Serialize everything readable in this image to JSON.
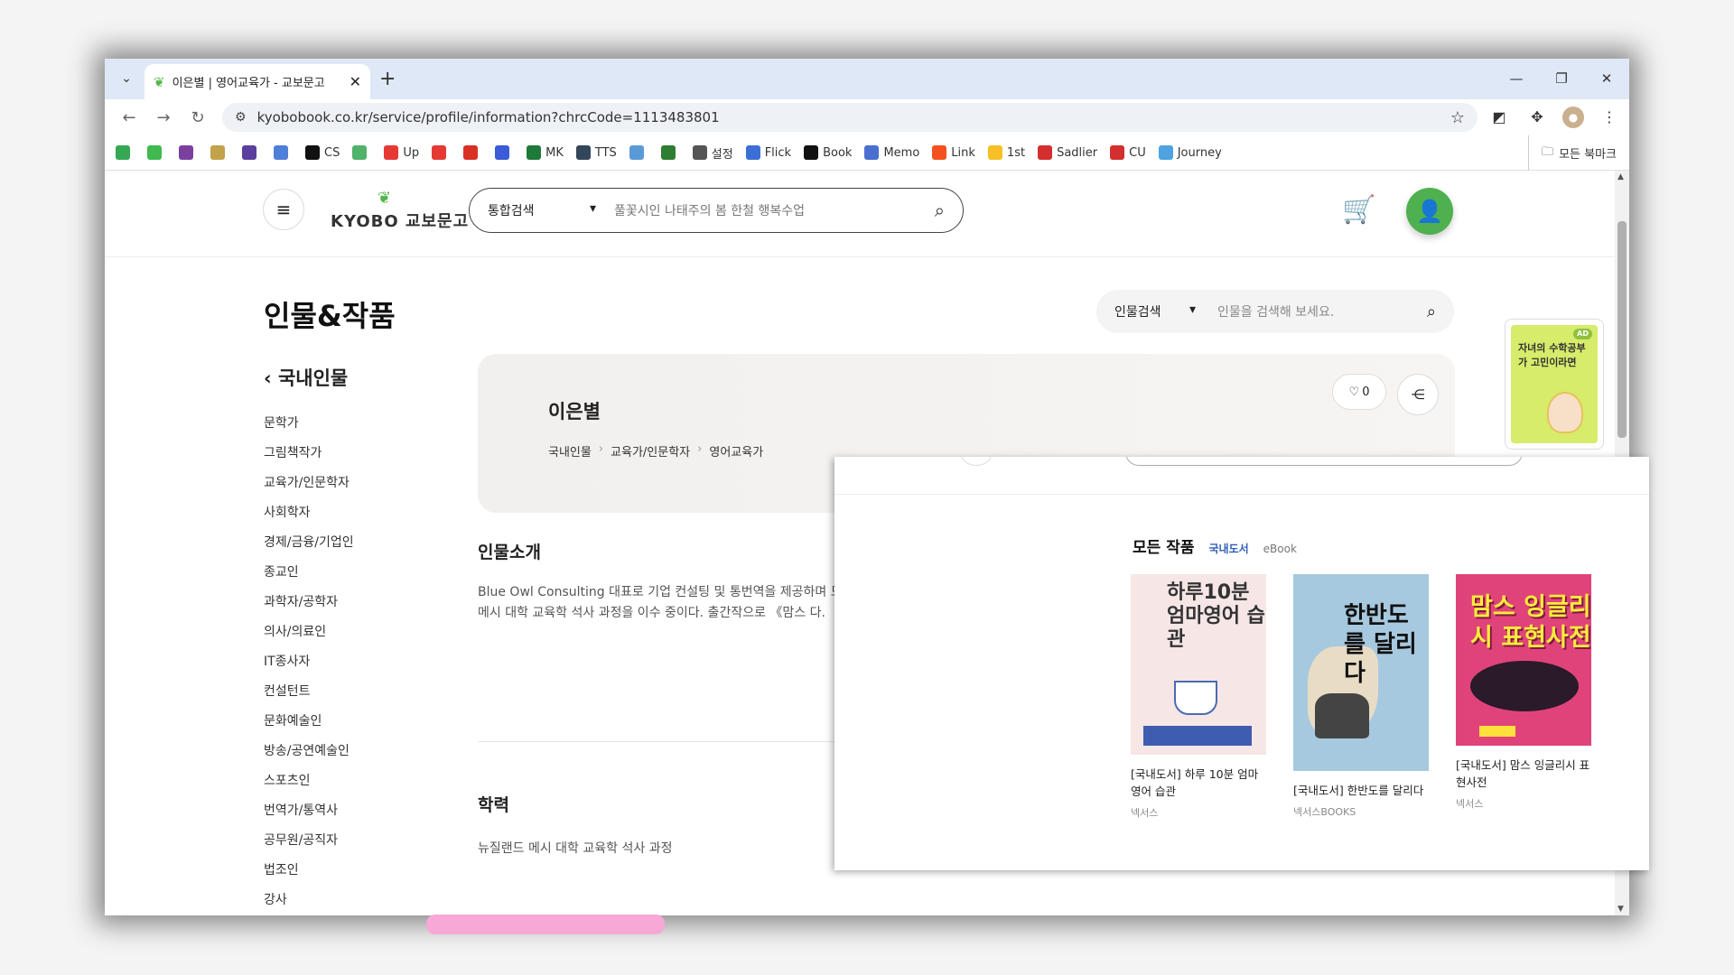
{
  "browser": {
    "tab_title": "이은별 | 영어교육가 - 교보문고",
    "url": "kyobobook.co.kr/service/profile/information?chrcCode=1113483801",
    "bookmarks": [
      {
        "label": "",
        "color": "#34a853"
      },
      {
        "label": "",
        "color": "#3fb950"
      },
      {
        "label": "",
        "color": "#7b3fa0"
      },
      {
        "label": "",
        "color": "#c2a24a"
      },
      {
        "label": "",
        "color": "#5b3f9c"
      },
      {
        "label": "",
        "color": "#4f7fd8"
      },
      {
        "label": "CS",
        "color": "#111111"
      },
      {
        "label": "",
        "color": "#50b36a"
      },
      {
        "label": "Up",
        "color": "#e53935"
      },
      {
        "label": "",
        "color": "#e53935"
      },
      {
        "label": "",
        "color": "#d93025"
      },
      {
        "label": "",
        "color": "#3c5bd9"
      },
      {
        "label": "MK",
        "color": "#1f7a3a"
      },
      {
        "label": "TTS",
        "color": "#33475b"
      },
      {
        "label": "",
        "color": "#5b9ad8"
      },
      {
        "label": "",
        "color": "#2e7d32"
      },
      {
        "label": "설정",
        "color": "#555555"
      },
      {
        "label": "Flick",
        "color": "#3b6fd6"
      },
      {
        "label": "Book",
        "color": "#111111"
      },
      {
        "label": "Memo",
        "color": "#4a6fd1"
      },
      {
        "label": "Link",
        "color": "#f4511e"
      },
      {
        "label": "1st",
        "color": "#f6c026"
      },
      {
        "label": "Sadlier",
        "color": "#d32f2f"
      },
      {
        "label": "CU",
        "color": "#d32f2f"
      },
      {
        "label": "Journey",
        "color": "#4fa3e0"
      }
    ],
    "all_bookmarks": "모든 북마크"
  },
  "header": {
    "logo_text": "KYOBO 교보문고",
    "search_category": "통합검색",
    "search_placeholder": "풀꽃시인 나태주의 봄 한철 행복수업"
  },
  "page": {
    "title": "인물&작품",
    "person_search_category": "인물검색",
    "person_search_placeholder": "인물을 검색해 보세요.",
    "ad_text": "자녀의 수학공부가 고민이라면",
    "ad_badge": "AD"
  },
  "sidebar": {
    "heading": "국내인물",
    "items": [
      "문학가",
      "그림책작가",
      "교육가/인문학자",
      "사회학자",
      "경제/금융/기업인",
      "종교인",
      "과학자/공학자",
      "의사/의료인",
      "IT종사자",
      "컨설턴트",
      "문화예술인",
      "방송/공연예술인",
      "스포츠인",
      "번역가/통역사",
      "공무원/공직자",
      "법조인",
      "강사"
    ]
  },
  "profile": {
    "name": "이은별",
    "breadcrumb": [
      "국내인물",
      "교육가/인문학자",
      "영어교육가"
    ],
    "like_count": "0"
  },
  "intro": {
    "title": "인물소개",
    "text": "Blue Owl Consulting 대표로 기업 컨설팅 및 통번역을 제공하며 드 메시 대학 교육학 석사 과정을 이수 중이다. 출간작으로 《맘스 다."
  },
  "education": {
    "title": "학력",
    "text": "뉴질랜드 메시 대학 교육학 석사 과정"
  },
  "works": {
    "heading": "모든 작품",
    "tab_domestic": "국내도서",
    "tab_ebook": "eBook",
    "books": [
      {
        "caption": "[국내도서] 하루 10분 엄마 영어 습관",
        "publisher": "넥서스",
        "cover_text": "하루10분 엄마영어 습관"
      },
      {
        "caption": "[국내도서] 한반도를 달리다",
        "publisher": "넥서스BOOKS",
        "cover_text": "한반도를 달리다"
      },
      {
        "caption": "[국내도서] 맘스 잉글리시 표현사전",
        "publisher": "넥서스",
        "cover_text": "맘스 잉글리시 표현사전"
      }
    ]
  }
}
